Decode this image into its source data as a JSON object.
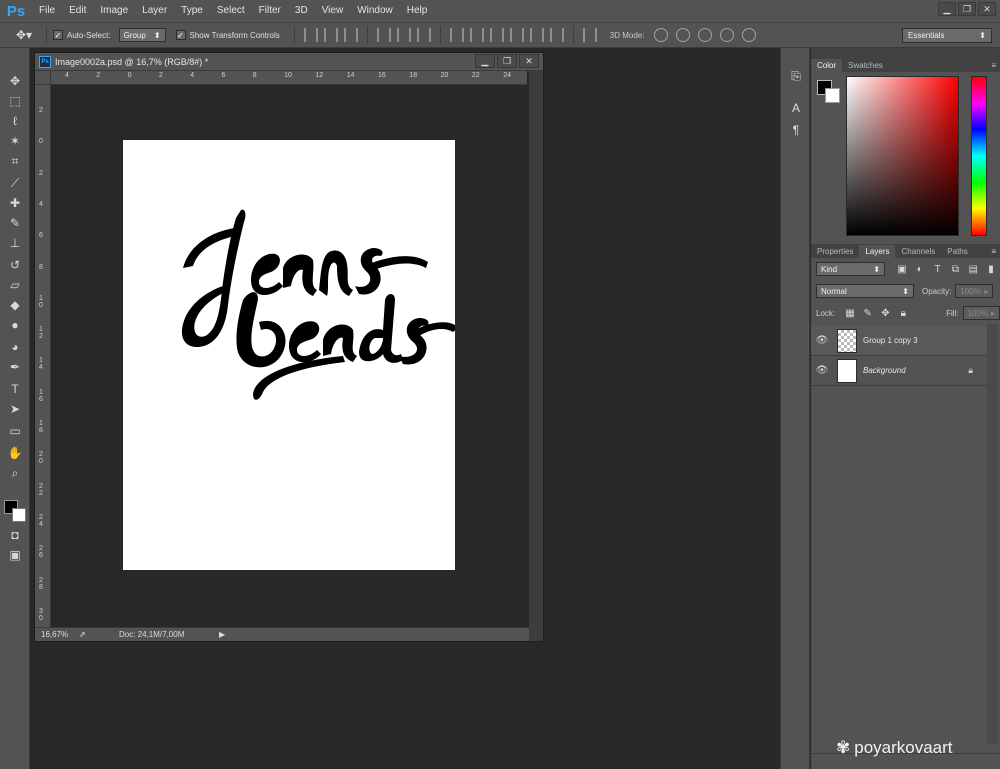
{
  "app": {
    "logo": "Ps"
  },
  "menu": [
    "File",
    "Edit",
    "Image",
    "Layer",
    "Type",
    "Select",
    "Filter",
    "3D",
    "View",
    "Window",
    "Help"
  ],
  "window_controls": {
    "minimize": "▁",
    "restore": "❐",
    "close": "✕"
  },
  "options_bar": {
    "auto_select_label": "Auto-Select:",
    "auto_select_value": "Group",
    "show_transform_label": "Show Transform Controls",
    "mode_3d_label": "3D Mode:",
    "workspace": "Essentials"
  },
  "document": {
    "title": "Image0002a.psd @ 16,7% (RGB/8#) *",
    "doc_icon": "Ps",
    "ruler_h": [
      "4",
      "2",
      "0",
      "2",
      "4",
      "6",
      "8",
      "10",
      "12",
      "14",
      "16",
      "18",
      "20",
      "22",
      "24"
    ],
    "ruler_v": [
      "2",
      "0",
      "2",
      "4",
      "6",
      "8",
      "1 0",
      "1 2",
      "1 4",
      "1 6",
      "1 8",
      "2 0",
      "2 2",
      "2 4",
      "2 6",
      "2 8",
      "3 0"
    ],
    "zoom": "16,67%",
    "doc_size": "Doc: 24,1M/7,00M",
    "artwork_word_1": "Jeans",
    "artwork_word_2": "beads"
  },
  "panels": {
    "color_tabs": [
      "Color",
      "Swatches"
    ],
    "layer_tabs": [
      "Properties",
      "Layers",
      "Channels",
      "Paths"
    ],
    "filter_kind": "Kind",
    "blend_mode": "Normal",
    "opacity_label": "Opacity:",
    "opacity_value": "100%",
    "lock_label": "Lock:",
    "fill_label": "Fill:",
    "fill_value": "100%",
    "layers": [
      {
        "name": "Group 1 copy 3"
      },
      {
        "name": "Background"
      }
    ]
  },
  "watermark": "poyarkovaart"
}
